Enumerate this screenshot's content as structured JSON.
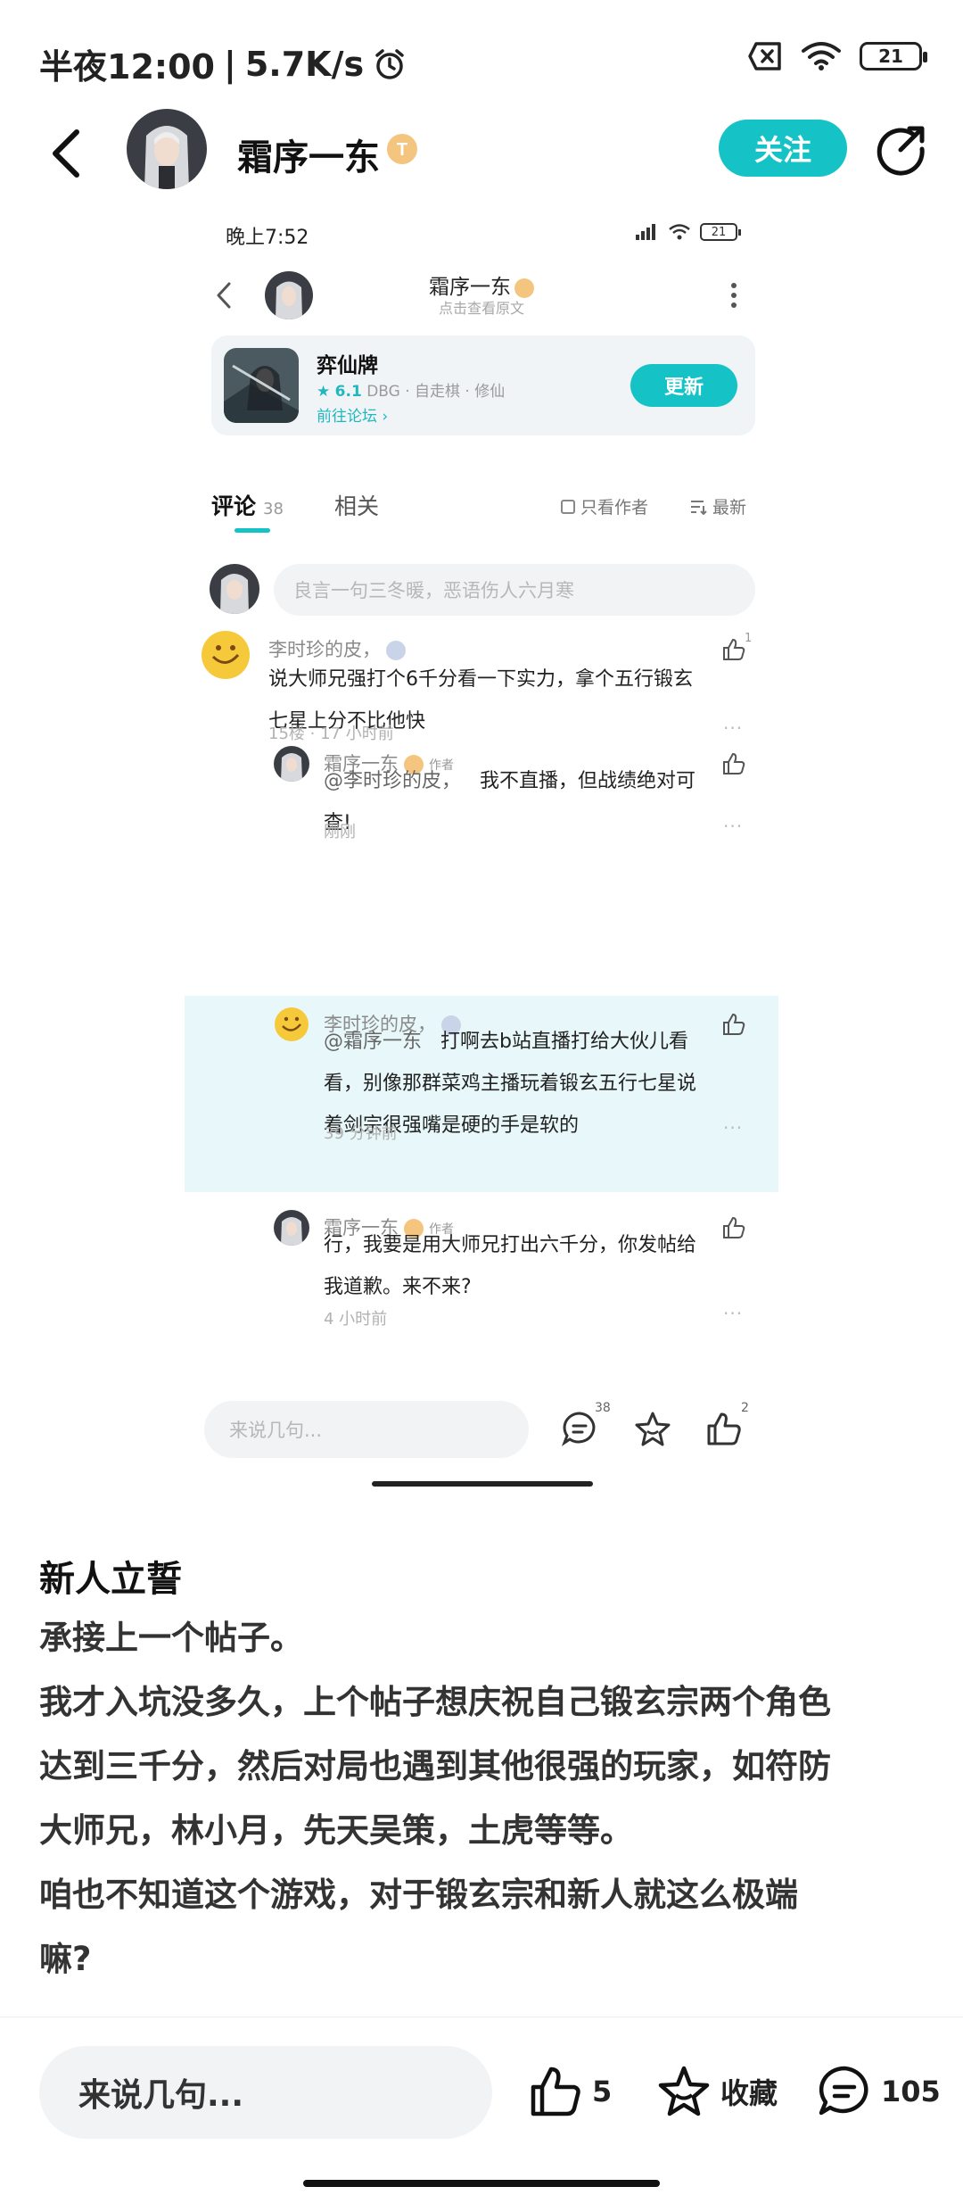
{
  "status": {
    "time": "半夜12:00",
    "separator": "|",
    "speed": "5.7K/s",
    "battery": "21"
  },
  "header": {
    "author_name": "霜序一东",
    "follow_label": "关注"
  },
  "embedded": {
    "status_time": "晚上7:52",
    "battery": "21",
    "title": "霜序一东",
    "subtitle": "点击查看原文",
    "game": {
      "name": "弈仙牌",
      "score": "6.1",
      "tags": "DBG · 自走棋 · 修仙",
      "forum_link": "前往论坛",
      "update_label": "更新"
    },
    "tabs": {
      "comments_label": "评论",
      "comments_count": "38",
      "related_label": "相关",
      "author_only_label": "只看作者",
      "newest_label": "最新"
    },
    "comment_placeholder": "良言一句三冬暖，恶语伤人六月寒",
    "comments": [
      {
        "name": "李时珍的皮，",
        "text_line1": "说大师兄强打个6千分看一下实力，拿个五行锻玄",
        "text_line2": "七星上分不比他快",
        "meta": "15楼 · 17 小时前",
        "likes": "1"
      },
      {
        "name": "霜序一东",
        "author_tag": "作者",
        "mention": "@李时珍的皮，",
        "text_line1": "我不直播，但战绩绝对可",
        "text_line2": "查!",
        "meta": "刚刚"
      },
      {
        "name": "李时珍的皮，",
        "mention": "@霜序一东",
        "text_line1": "打啊去b站直播打给大伙儿看",
        "text_line2": "看，别像那群菜鸡主播玩着锻玄五行七星说",
        "text_line3": "着剑宗很强嘴是硬的手是软的",
        "meta": "39 分钟前"
      },
      {
        "name": "霜序一东",
        "author_tag": "作者",
        "text_line1": "行，我要是用大师兄打出六千分，你发帖给",
        "text_line2": "我道歉。来不来?",
        "meta": "4 小时前"
      }
    ],
    "bottom": {
      "placeholder": "来说几句...",
      "comment_count": "38",
      "like_count": "2"
    }
  },
  "post": {
    "title": "新人立誓",
    "paragraphs": [
      "承接上一个帖子。",
      "我才入坑没多久，上个帖子想庆祝自己锻玄宗两个角色",
      "达到三千分，然后对局也遇到其他很强的玩家，如符防",
      "大师兄，林小月，先天吴策，土虎等等。",
      "咱也不知道这个游戏，对于锻玄宗和新人就这么极端",
      "嘛?"
    ]
  },
  "bottom_bar": {
    "placeholder": "来说几句...",
    "likes": "5",
    "favorite_label": "收藏",
    "comments": "105"
  },
  "colors": {
    "accent": "#15c3c6",
    "highlight": "#e8f7f9",
    "badge": "#f3c57f"
  }
}
